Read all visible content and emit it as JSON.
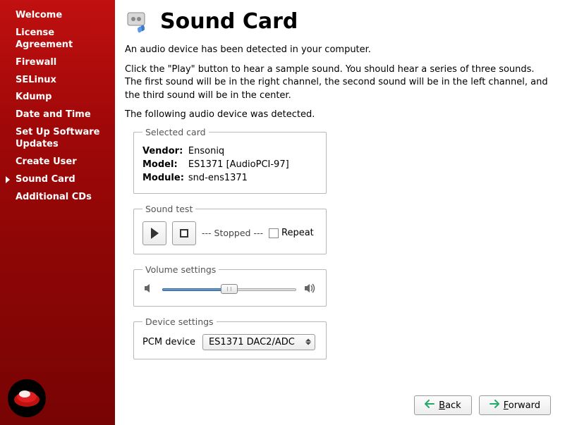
{
  "sidebar": {
    "items": [
      {
        "label": "Welcome"
      },
      {
        "label": "License Agreement"
      },
      {
        "label": "Firewall"
      },
      {
        "label": "SELinux"
      },
      {
        "label": "Kdump"
      },
      {
        "label": "Date and Time"
      },
      {
        "label": "Set Up Software Updates"
      },
      {
        "label": "Create User"
      },
      {
        "label": "Sound Card"
      },
      {
        "label": "Additional CDs"
      }
    ]
  },
  "header": {
    "title": "Sound Card"
  },
  "intro": {
    "line1": "An audio device has been detected in your computer.",
    "line2": "Click the \"Play\" button to hear a sample sound.  You should hear a series of three sounds.  The first sound will be in the right channel, the second sound will be in the left channel, and the third sound will be in the center.",
    "line3": "The following audio device was detected."
  },
  "selected_card": {
    "legend": "Selected card",
    "vendor_label": "Vendor:",
    "vendor_value": "Ensoniq",
    "model_label": "Model:",
    "model_value": "ES1371 [AudioPCI-97]",
    "module_label": "Module:",
    "module_value": "snd-ens1371"
  },
  "sound_test": {
    "legend": "Sound test",
    "status": "--- Stopped ---",
    "repeat_label": "Repeat"
  },
  "volume": {
    "legend": "Volume settings",
    "percent": 50
  },
  "device": {
    "legend": "Device settings",
    "label": "PCM device",
    "selected": "ES1371 DAC2/ADC"
  },
  "footer": {
    "back": "Back",
    "forward": "Forward"
  }
}
